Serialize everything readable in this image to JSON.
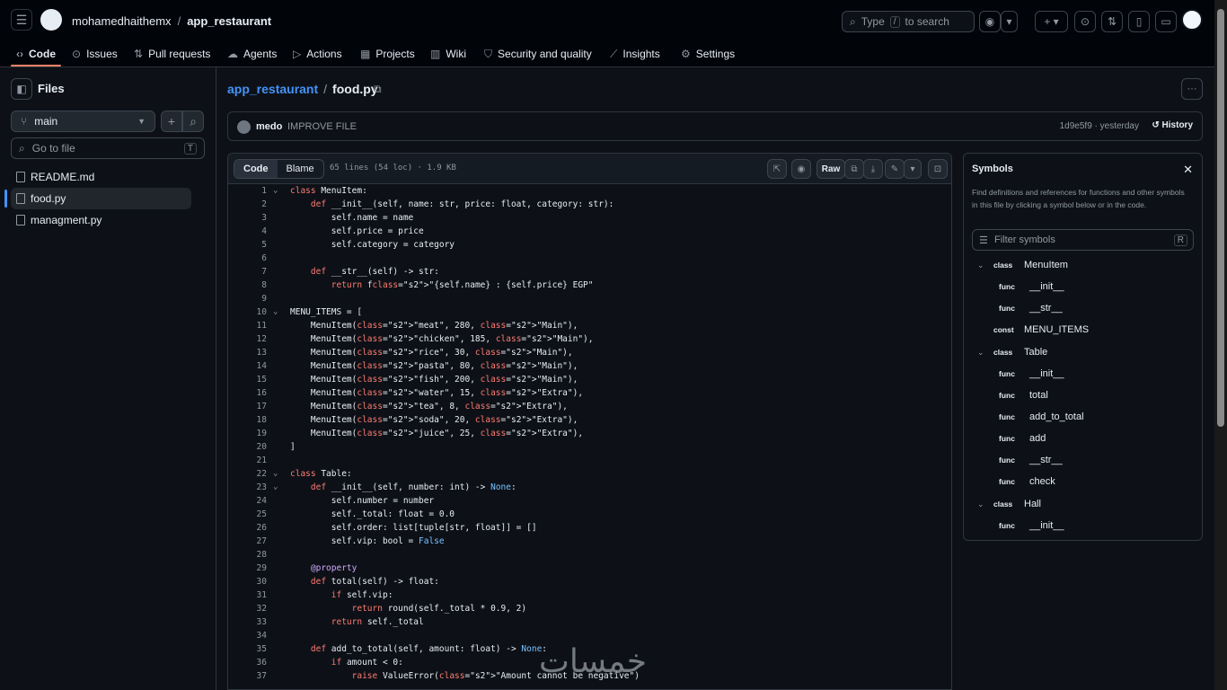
{
  "header": {
    "owner": "mohamedhaithemx",
    "repo": "app_restaurant",
    "search_placeholder": "Type",
    "search_key": "/",
    "search_suffix": "to search"
  },
  "nav_tabs": [
    {
      "label": "Code"
    },
    {
      "label": "Issues"
    },
    {
      "label": "Pull requests"
    },
    {
      "label": "Agents"
    },
    {
      "label": "Actions"
    },
    {
      "label": "Projects"
    },
    {
      "label": "Wiki"
    },
    {
      "label": "Security and quality"
    },
    {
      "label": "Insights"
    },
    {
      "label": "Settings"
    }
  ],
  "sidebar": {
    "title": "Files",
    "branch": "main",
    "goto_placeholder": "Go to file",
    "goto_key": "T",
    "files": [
      {
        "name": "README.md"
      },
      {
        "name": "food.py"
      },
      {
        "name": "managment.py"
      }
    ]
  },
  "file": {
    "repo": "app_restaurant",
    "name": "food.py",
    "commit_author": "medo",
    "commit_message": "IMPROVE FILE",
    "commit_sha": "1d9e5f9 · yesterday",
    "history_label": "History",
    "view_code": "Code",
    "view_blame": "Blame",
    "meta": "65 lines (54 loc) · 1.9 KB",
    "raw_label": "Raw"
  },
  "code_lines": [
    {
      "n": "1",
      "t": "class MenuItem:"
    },
    {
      "n": "2",
      "t": "    def __init__(self, name: str, price: float, category: str):"
    },
    {
      "n": "3",
      "t": "        self.name = name"
    },
    {
      "n": "4",
      "t": "        self.price = price"
    },
    {
      "n": "5",
      "t": "        self.category = category"
    },
    {
      "n": "6",
      "t": ""
    },
    {
      "n": "7",
      "t": "    def __str__(self) -> str:"
    },
    {
      "n": "8",
      "t": "        return f\"{self.name} : {self.price} EGP\""
    },
    {
      "n": "9",
      "t": ""
    },
    {
      "n": "10",
      "t": "MENU_ITEMS = ["
    },
    {
      "n": "11",
      "t": "    MenuItem(\"meat\", 280, \"Main\"),"
    },
    {
      "n": "12",
      "t": "    MenuItem(\"chicken\", 185, \"Main\"),"
    },
    {
      "n": "13",
      "t": "    MenuItem(\"rice\", 30, \"Main\"),"
    },
    {
      "n": "14",
      "t": "    MenuItem(\"pasta\", 80, \"Main\"),"
    },
    {
      "n": "15",
      "t": "    MenuItem(\"fish\", 200, \"Main\"),"
    },
    {
      "n": "16",
      "t": "    MenuItem(\"water\", 15, \"Extra\"),"
    },
    {
      "n": "17",
      "t": "    MenuItem(\"tea\", 8, \"Extra\"),"
    },
    {
      "n": "18",
      "t": "    MenuItem(\"soda\", 20, \"Extra\"),"
    },
    {
      "n": "19",
      "t": "    MenuItem(\"juice\", 25, \"Extra\"),"
    },
    {
      "n": "20",
      "t": "]"
    },
    {
      "n": "21",
      "t": ""
    },
    {
      "n": "22",
      "t": "class Table:"
    },
    {
      "n": "23",
      "t": "    def __init__(self, number: int) -> None:"
    },
    {
      "n": "24",
      "t": "        self.number = number"
    },
    {
      "n": "25",
      "t": "        self._total: float = 0.0"
    },
    {
      "n": "26",
      "t": "        self.order: list[tuple[str, float]] = []"
    },
    {
      "n": "27",
      "t": "        self.vip: bool = False"
    },
    {
      "n": "28",
      "t": ""
    },
    {
      "n": "29",
      "t": "    @property"
    },
    {
      "n": "30",
      "t": "    def total(self) -> float:"
    },
    {
      "n": "31",
      "t": "        if self.vip:"
    },
    {
      "n": "32",
      "t": "            return round(self._total * 0.9, 2)"
    },
    {
      "n": "33",
      "t": "        return self._total"
    },
    {
      "n": "34",
      "t": ""
    },
    {
      "n": "35",
      "t": "    def add_to_total(self, amount: float) -> None:"
    },
    {
      "n": "36",
      "t": "        if amount < 0:"
    },
    {
      "n": "37",
      "t": "            raise ValueError(\"Amount cannot be negative\")"
    }
  ],
  "symbols": {
    "title": "Symbols",
    "description": "Find definitions and references for functions and other symbols in this file by clicking a symbol below or in the code.",
    "filter_placeholder": "Filter symbols",
    "filter_key": "R",
    "items": [
      {
        "kind": "class",
        "name": "MenuItem"
      },
      {
        "kind": "func",
        "name": "__init__"
      },
      {
        "kind": "func",
        "name": "__str__"
      },
      {
        "kind": "const",
        "name": "MENU_ITEMS"
      },
      {
        "kind": "class",
        "name": "Table"
      },
      {
        "kind": "func",
        "name": "__init__"
      },
      {
        "kind": "func",
        "name": "total"
      },
      {
        "kind": "func",
        "name": "add_to_total"
      },
      {
        "kind": "func",
        "name": "add"
      },
      {
        "kind": "func",
        "name": "__str__"
      },
      {
        "kind": "func",
        "name": "check"
      },
      {
        "kind": "class",
        "name": "Hall"
      },
      {
        "kind": "func",
        "name": "__init__"
      }
    ]
  },
  "watermark": "خمسات",
  "colors": {
    "accent": "#4493f8",
    "tab_underline": "#f78166",
    "bg": "#0d1117"
  }
}
